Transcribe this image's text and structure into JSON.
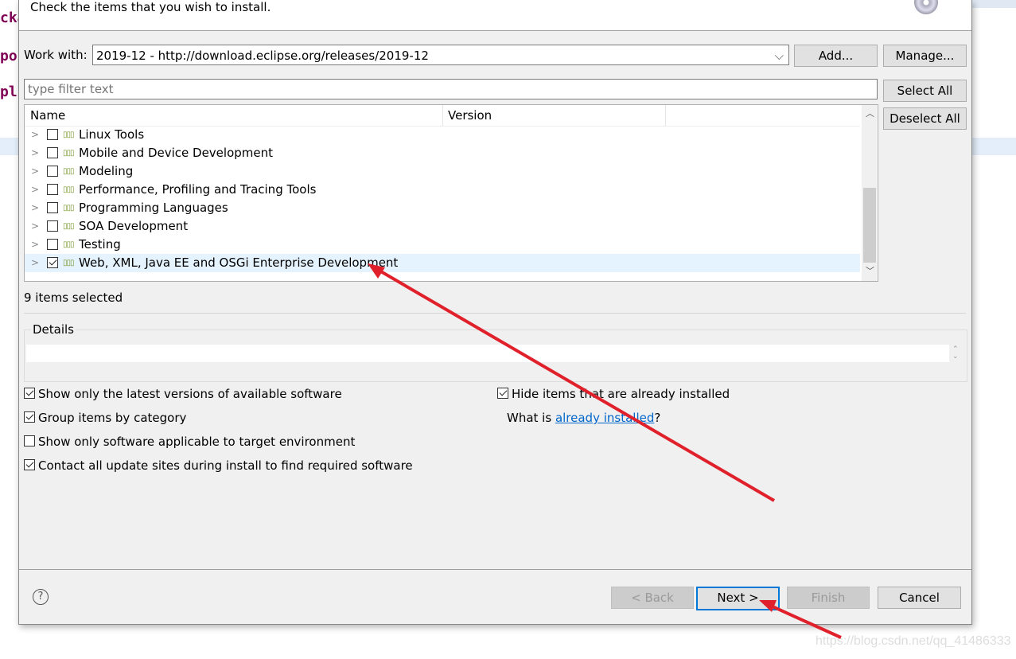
{
  "background": {
    "code_fragments": [
      "cka",
      "por",
      "pli"
    ]
  },
  "dialog": {
    "instruction": "Check the items that you wish to install.",
    "work_with_label": "Work with:",
    "work_with_value": "2019-12 - http://download.eclipse.org/releases/2019-12",
    "add_label": "Add...",
    "manage_label": "Manage...",
    "filter_placeholder": "type filter text",
    "select_all_label": "Select All",
    "deselect_all_label": "Deselect All",
    "columns": [
      "Name",
      "Version"
    ],
    "items": [
      {
        "label": "Linux Tools",
        "checked": false
      },
      {
        "label": "Mobile and Device Development",
        "checked": false
      },
      {
        "label": "Modeling",
        "checked": false
      },
      {
        "label": "Performance, Profiling and Tracing Tools",
        "checked": false
      },
      {
        "label": "Programming Languages",
        "checked": false
      },
      {
        "label": "SOA Development",
        "checked": false
      },
      {
        "label": "Testing",
        "checked": false
      },
      {
        "label": "Web, XML, Java EE and OSGi Enterprise Development",
        "checked": true,
        "selected": true
      }
    ],
    "selection_status": "9 items selected",
    "details_label": "Details",
    "options": [
      {
        "label": "Show only the latest versions of available software",
        "checked": true
      },
      {
        "label": "Group items by category",
        "checked": true
      },
      {
        "label": "Show only software applicable to target environment",
        "checked": false
      },
      {
        "label": "Contact all update sites during install to find required software",
        "checked": true
      },
      {
        "label": "Hide items that are already installed",
        "checked": true
      }
    ],
    "what_is": "What is ",
    "already_installed_link": "already installed",
    "question_mark": "?",
    "back_label": "< Back",
    "next_label": "Next >",
    "finish_label": "Finish",
    "cancel_label": "Cancel"
  },
  "watermark": "https://blog.csdn.net/qq_41486333",
  "colors": {
    "annotation_arrow": "#e0202a",
    "link": "#0066cc",
    "selection": "#e5f3ff"
  }
}
